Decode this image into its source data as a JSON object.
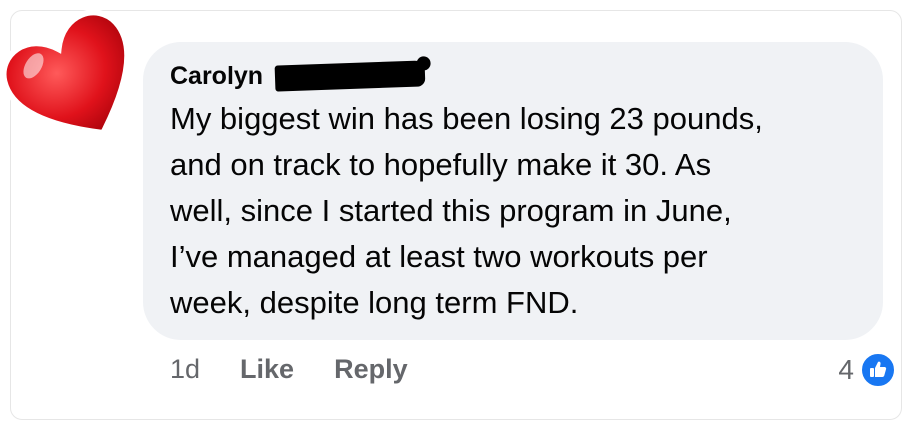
{
  "comment": {
    "author_name": "Carolyn",
    "text_lines": [
      "My biggest win has been losing 23 pounds,",
      "and on track to hopefully make it 30. As",
      "well, since I started this program in June,",
      "I’ve managed at least two workouts per",
      "week, despite long term FND."
    ],
    "timestamp": "1d",
    "like_label": "Like",
    "reply_label": "Reply",
    "reaction_count": "4",
    "reaction_icon": "thumbs-up-icon"
  },
  "decoration": {
    "sticker": "heart-icon",
    "heart_color": "#e0121b",
    "reaction_color": "#1877f2"
  }
}
